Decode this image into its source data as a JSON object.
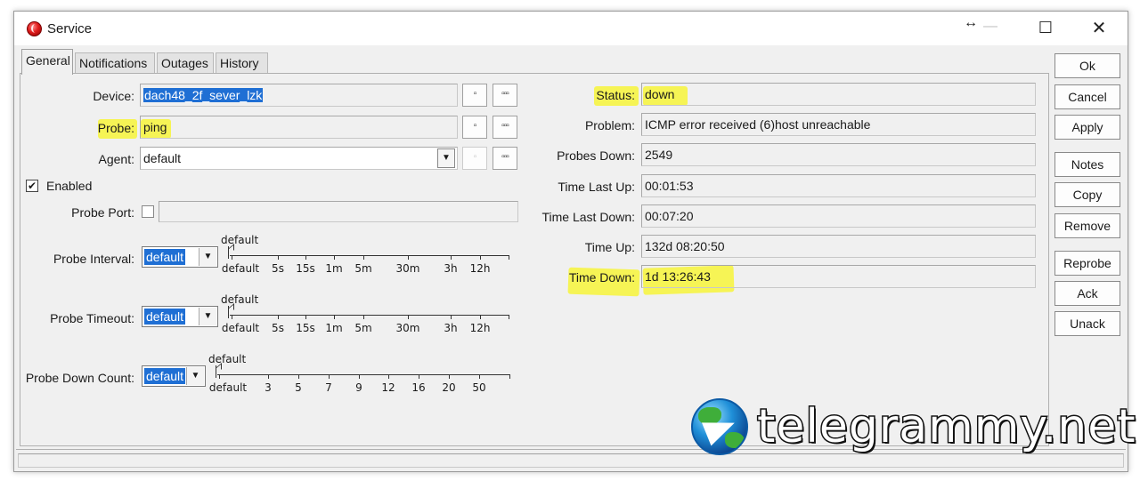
{
  "window": {
    "title": "Service",
    "resize_glyph": "↔",
    "minimize_glyph": "—",
    "maximize_glyph": "☐",
    "close_glyph": "✕"
  },
  "tabs": [
    {
      "label": "General",
      "active": true
    },
    {
      "label": "Notifications",
      "active": false
    },
    {
      "label": "Outages",
      "active": false
    },
    {
      "label": "History",
      "active": false
    }
  ],
  "general": {
    "device": {
      "label": "Device:",
      "value": "dach48_2f_sever_lzk"
    },
    "probe": {
      "label": "Probe:",
      "value": "ping"
    },
    "agent": {
      "label": "Agent:",
      "value": "default"
    },
    "enabled": {
      "label": "Enabled",
      "checked": true,
      "mark": "✔"
    },
    "probe_port": {
      "label": "Probe Port:",
      "checked": false
    },
    "small_btn": "▫",
    "dots_btn": "▫▫▫",
    "dropdown_arrow": "▼",
    "probe_interval": {
      "label": "Probe Interval:",
      "value": "default",
      "current": "default",
      "ticks": [
        "default",
        "5s",
        "15s",
        "1m",
        "5m",
        "30m",
        "3h",
        "12h"
      ]
    },
    "probe_timeout": {
      "label": "Probe Timeout:",
      "value": "default",
      "current": "default",
      "ticks": [
        "default",
        "5s",
        "15s",
        "1m",
        "5m",
        "30m",
        "3h",
        "12h"
      ]
    },
    "probe_down_count": {
      "label": "Probe Down Count:",
      "value": "default",
      "current": "default",
      "ticks": [
        "default",
        "3",
        "5",
        "7",
        "9",
        "12",
        "16",
        "20",
        "50"
      ]
    }
  },
  "status": {
    "status": {
      "label": "Status:",
      "value": "down"
    },
    "problem": {
      "label": "Problem:",
      "value": "ICMP error received (6)host unreachable"
    },
    "probes_down": {
      "label": "Probes Down:",
      "value": "2549"
    },
    "time_last_up": {
      "label": "Time Last Up:",
      "value": "00:01:53"
    },
    "time_last_down": {
      "label": "Time Last Down:",
      "value": "00:07:20"
    },
    "time_up": {
      "label": "Time Up:",
      "value": "132d 08:20:50"
    },
    "time_down": {
      "label": "Time Down:",
      "value": "1d 13:26:43"
    }
  },
  "buttons": {
    "ok": "Ok",
    "cancel": "Cancel",
    "apply": "Apply",
    "notes": "Notes",
    "copy": "Copy",
    "remove": "Remove",
    "reprobe": "Reprobe",
    "ack": "Ack",
    "unack": "Unack"
  },
  "highlight_color": "#f7f53a",
  "selection_color": "#1f6fd4",
  "watermark": {
    "text": "telegrammy.net",
    "icon": "telegram-globe-icon"
  }
}
